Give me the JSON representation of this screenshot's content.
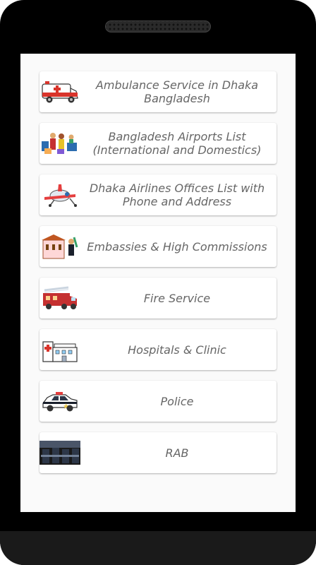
{
  "services": [
    {
      "label": "Ambulance Service in Dhaka\nBangladesh",
      "icon": "ambulance-icon"
    },
    {
      "label": "Bangladesh Airports List\n(International and Domestics)",
      "icon": "airport-travelers-icon"
    },
    {
      "label": "Dhaka Airlines Offices List with\nPhone and Address",
      "icon": "airplane-icon"
    },
    {
      "label": "Embassies & High Commissions",
      "icon": "embassy-icon"
    },
    {
      "label": "Fire Service",
      "icon": "fire-truck-icon"
    },
    {
      "label": "Hospitals & Clinic",
      "icon": "hospital-icon"
    },
    {
      "label": "Police",
      "icon": "police-car-icon"
    },
    {
      "label": "RAB",
      "icon": "rab-officers-icon"
    }
  ]
}
